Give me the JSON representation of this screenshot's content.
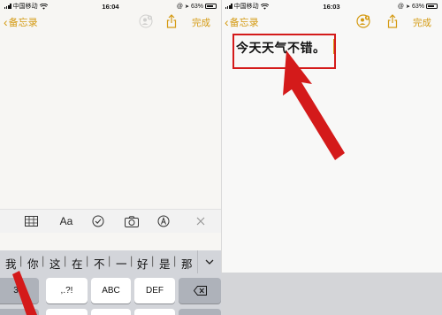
{
  "left": {
    "status": {
      "carrier": "中国移动",
      "time": "16:04",
      "battery": "63%"
    },
    "nav": {
      "back_label": "备忘录",
      "done_label": "完成"
    },
    "candidates": [
      "我",
      "你",
      "这",
      "在",
      "不",
      "一",
      "好",
      "是",
      "那"
    ],
    "candidate_separator": "|",
    "keys": {
      "k1": "3",
      "k2": ",.?!",
      "k3": "ABC",
      "k4": "DEF"
    },
    "toolbar": [
      "table-icon",
      "format-text",
      "checklist-icon",
      "camera-icon",
      "markup-icon",
      "close-icon"
    ],
    "toolbar_format_label": "Aa"
  },
  "right": {
    "status": {
      "carrier": "中国移动",
      "time": "16:03",
      "battery": "63%"
    },
    "nav": {
      "back_label": "备忘录",
      "done_label": "完成"
    },
    "note_text": "今天天气不错。"
  },
  "colors": {
    "accent": "#d49a12",
    "annotation": "#d41a1a"
  }
}
